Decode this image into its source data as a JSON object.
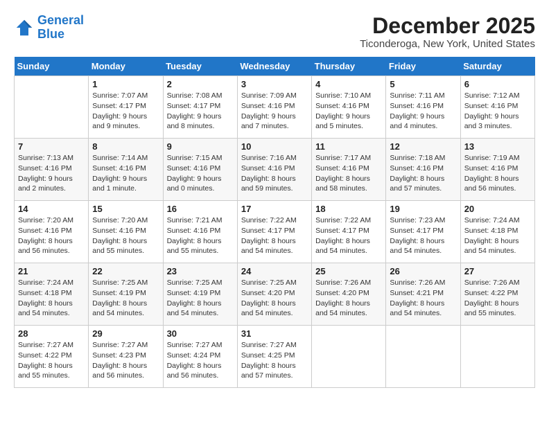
{
  "logo": {
    "line1": "General",
    "line2": "Blue"
  },
  "title": "December 2025",
  "location": "Ticonderoga, New York, United States",
  "days_of_week": [
    "Sunday",
    "Monday",
    "Tuesday",
    "Wednesday",
    "Thursday",
    "Friday",
    "Saturday"
  ],
  "weeks": [
    [
      {
        "day": "",
        "info": ""
      },
      {
        "day": "1",
        "info": "Sunrise: 7:07 AM\nSunset: 4:17 PM\nDaylight: 9 hours\nand 9 minutes."
      },
      {
        "day": "2",
        "info": "Sunrise: 7:08 AM\nSunset: 4:17 PM\nDaylight: 9 hours\nand 8 minutes."
      },
      {
        "day": "3",
        "info": "Sunrise: 7:09 AM\nSunset: 4:16 PM\nDaylight: 9 hours\nand 7 minutes."
      },
      {
        "day": "4",
        "info": "Sunrise: 7:10 AM\nSunset: 4:16 PM\nDaylight: 9 hours\nand 5 minutes."
      },
      {
        "day": "5",
        "info": "Sunrise: 7:11 AM\nSunset: 4:16 PM\nDaylight: 9 hours\nand 4 minutes."
      },
      {
        "day": "6",
        "info": "Sunrise: 7:12 AM\nSunset: 4:16 PM\nDaylight: 9 hours\nand 3 minutes."
      }
    ],
    [
      {
        "day": "7",
        "info": "Sunrise: 7:13 AM\nSunset: 4:16 PM\nDaylight: 9 hours\nand 2 minutes."
      },
      {
        "day": "8",
        "info": "Sunrise: 7:14 AM\nSunset: 4:16 PM\nDaylight: 9 hours\nand 1 minute."
      },
      {
        "day": "9",
        "info": "Sunrise: 7:15 AM\nSunset: 4:16 PM\nDaylight: 9 hours\nand 0 minutes."
      },
      {
        "day": "10",
        "info": "Sunrise: 7:16 AM\nSunset: 4:16 PM\nDaylight: 8 hours\nand 59 minutes."
      },
      {
        "day": "11",
        "info": "Sunrise: 7:17 AM\nSunset: 4:16 PM\nDaylight: 8 hours\nand 58 minutes."
      },
      {
        "day": "12",
        "info": "Sunrise: 7:18 AM\nSunset: 4:16 PM\nDaylight: 8 hours\nand 57 minutes."
      },
      {
        "day": "13",
        "info": "Sunrise: 7:19 AM\nSunset: 4:16 PM\nDaylight: 8 hours\nand 56 minutes."
      }
    ],
    [
      {
        "day": "14",
        "info": "Sunrise: 7:20 AM\nSunset: 4:16 PM\nDaylight: 8 hours\nand 56 minutes."
      },
      {
        "day": "15",
        "info": "Sunrise: 7:20 AM\nSunset: 4:16 PM\nDaylight: 8 hours\nand 55 minutes."
      },
      {
        "day": "16",
        "info": "Sunrise: 7:21 AM\nSunset: 4:16 PM\nDaylight: 8 hours\nand 55 minutes."
      },
      {
        "day": "17",
        "info": "Sunrise: 7:22 AM\nSunset: 4:17 PM\nDaylight: 8 hours\nand 54 minutes."
      },
      {
        "day": "18",
        "info": "Sunrise: 7:22 AM\nSunset: 4:17 PM\nDaylight: 8 hours\nand 54 minutes."
      },
      {
        "day": "19",
        "info": "Sunrise: 7:23 AM\nSunset: 4:17 PM\nDaylight: 8 hours\nand 54 minutes."
      },
      {
        "day": "20",
        "info": "Sunrise: 7:24 AM\nSunset: 4:18 PM\nDaylight: 8 hours\nand 54 minutes."
      }
    ],
    [
      {
        "day": "21",
        "info": "Sunrise: 7:24 AM\nSunset: 4:18 PM\nDaylight: 8 hours\nand 54 minutes."
      },
      {
        "day": "22",
        "info": "Sunrise: 7:25 AM\nSunset: 4:19 PM\nDaylight: 8 hours\nand 54 minutes."
      },
      {
        "day": "23",
        "info": "Sunrise: 7:25 AM\nSunset: 4:19 PM\nDaylight: 8 hours\nand 54 minutes."
      },
      {
        "day": "24",
        "info": "Sunrise: 7:25 AM\nSunset: 4:20 PM\nDaylight: 8 hours\nand 54 minutes."
      },
      {
        "day": "25",
        "info": "Sunrise: 7:26 AM\nSunset: 4:20 PM\nDaylight: 8 hours\nand 54 minutes."
      },
      {
        "day": "26",
        "info": "Sunrise: 7:26 AM\nSunset: 4:21 PM\nDaylight: 8 hours\nand 54 minutes."
      },
      {
        "day": "27",
        "info": "Sunrise: 7:26 AM\nSunset: 4:22 PM\nDaylight: 8 hours\nand 55 minutes."
      }
    ],
    [
      {
        "day": "28",
        "info": "Sunrise: 7:27 AM\nSunset: 4:22 PM\nDaylight: 8 hours\nand 55 minutes."
      },
      {
        "day": "29",
        "info": "Sunrise: 7:27 AM\nSunset: 4:23 PM\nDaylight: 8 hours\nand 56 minutes."
      },
      {
        "day": "30",
        "info": "Sunrise: 7:27 AM\nSunset: 4:24 PM\nDaylight: 8 hours\nand 56 minutes."
      },
      {
        "day": "31",
        "info": "Sunrise: 7:27 AM\nSunset: 4:25 PM\nDaylight: 8 hours\nand 57 minutes."
      },
      {
        "day": "",
        "info": ""
      },
      {
        "day": "",
        "info": ""
      },
      {
        "day": "",
        "info": ""
      }
    ]
  ]
}
